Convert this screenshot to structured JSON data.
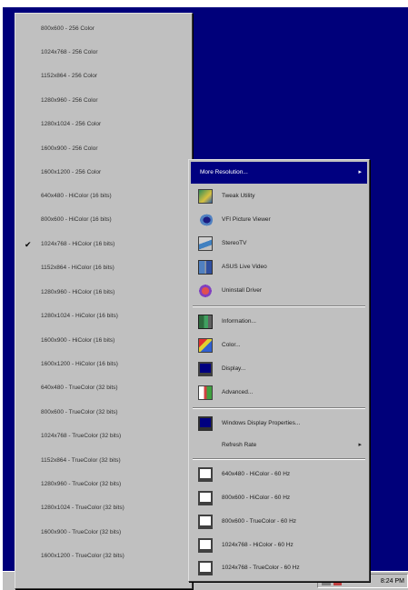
{
  "resolution_menu": {
    "items": [
      {
        "label": "800x600 - 256 Color",
        "checked": false
      },
      {
        "label": "1024x768 - 256 Color",
        "checked": false
      },
      {
        "label": "1152x864 - 256 Color",
        "checked": false
      },
      {
        "label": "1280x960 - 256 Color",
        "checked": false
      },
      {
        "label": "1280x1024 - 256 Color",
        "checked": false
      },
      {
        "label": "1600x900 - 256 Color",
        "checked": false
      },
      {
        "label": "1600x1200 - 256 Color",
        "checked": false
      },
      {
        "label": "640x480 - HiColor (16 bits)",
        "checked": false
      },
      {
        "label": "800x600 - HiColor (16 bits)",
        "checked": false
      },
      {
        "label": "1024x768 - HiColor (16 bits)",
        "checked": true
      },
      {
        "label": "1152x864 - HiColor (16 bits)",
        "checked": false
      },
      {
        "label": "1280x960 - HiColor (16 bits)",
        "checked": false
      },
      {
        "label": "1280x1024 - HiColor (16 bits)",
        "checked": false
      },
      {
        "label": "1600x900 - HiColor (16 bits)",
        "checked": false
      },
      {
        "label": "1600x1200 - HiColor (16 bits)",
        "checked": false
      },
      {
        "label": "640x480 - TrueColor (32 bits)",
        "checked": false
      },
      {
        "label": "800x600 - TrueColor (32 bits)",
        "checked": false
      },
      {
        "label": "1024x768 - TrueColor (32 bits)",
        "checked": false
      },
      {
        "label": "1152x864 - TrueColor (32 bits)",
        "checked": false
      },
      {
        "label": "1280x960 - TrueColor (32 bits)",
        "checked": false
      },
      {
        "label": "1280x1024 - TrueColor (32 bits)",
        "checked": false
      },
      {
        "label": "1600x900 - TrueColor (32 bits)",
        "checked": false
      },
      {
        "label": "1600x1200 - TrueColor (32 bits)",
        "checked": false
      }
    ]
  },
  "context_menu": {
    "more_resolution": "More Resolution...",
    "tweak_utility": "Tweak Utility",
    "picture_viewer": "VFI Picture Viewer",
    "stereo_tv": "StereoTV",
    "live_video": "ASUS Live Video",
    "uninstall_driver": "Uninstall Driver",
    "information": "Information...",
    "color": "Color...",
    "display": "Display...",
    "advanced": "Advanced...",
    "windows_display_properties": "Windows Display Properties...",
    "refresh_rate": "Refresh Rate",
    "quick_modes": [
      "640x480 - HiColor - 60 Hz",
      "800x600 - HiColor - 60 Hz",
      "800x600 - TrueColor - 60 Hz",
      "1024x768 - HiColor - 60 Hz",
      "1024x768 - TrueColor - 60 Hz"
    ],
    "submenu_arrow": "▸"
  },
  "taskbar": {
    "clock": "8:24 PM"
  },
  "colors": {
    "desktop": "#00007a",
    "menu": "#c0c0c0",
    "highlight": "#000080"
  }
}
